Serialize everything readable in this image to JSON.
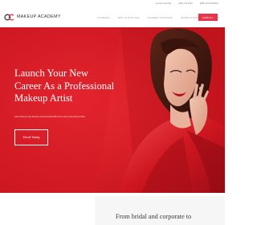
{
  "topbar": {
    "items": [
      "[email protected]",
      "(256) 729 4549",
      "(888) 444-WRRRTS"
    ]
  },
  "header": {
    "logo_text": "MAKEUP ACADEMY",
    "nav": [
      "COURSES",
      "WHY OUR PLACE",
      "STUDENT SUCCESS",
      "INSTRUCTORS",
      "CONTACT"
    ],
    "enroll_label": "ENROLL"
  },
  "hero": {
    "title_lines": [
      "Launch Your New",
      "Career As a Professional",
      "Makeup Artist"
    ],
    "subtitle": "Learn how you can become a licensed and ASLS 21 in only a few short months",
    "button_label": "Enroll Today"
  },
  "section": {
    "heading": "From bridal and corporate to"
  },
  "colors": {
    "brand_red": "#e8354a",
    "hero_red": "#d81b26"
  }
}
